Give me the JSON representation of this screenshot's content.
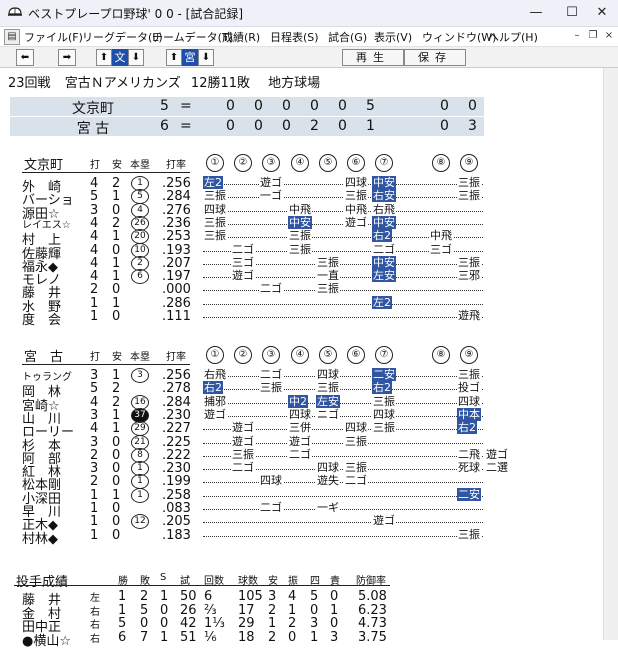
{
  "window": {
    "title": "ベストプレープロ野球' 0 0 - [試合記録]"
  },
  "menu": [
    "ファイル(F)",
    "リーグデータ(L)",
    "チームデータ(T)",
    "成績(R)",
    "日程表(S)",
    "試合(G)",
    "表示(V)",
    "ウィンドウ(W)",
    "ヘルプ(H)"
  ],
  "toolbar": {
    "prev": "⬅",
    "next": "➡",
    "up": "⬆",
    "down": "⬇",
    "bun_label": "文",
    "miyako_label": "宮",
    "replay_label": "再生",
    "save_label": "保存"
  },
  "game": {
    "round": "23回戦",
    "matchup": "宮古Ｎアメリカンズ",
    "record": "12勝11敗",
    "venue": "地方球場"
  },
  "scoreboard": [
    {
      "team": "文京町",
      "runs": "5",
      "innings": [
        "0",
        "0",
        "0",
        "0",
        "0",
        "5"
      ],
      "hits": "0",
      "errors": "0"
    },
    {
      "team": "宮 古",
      "runs": "6",
      "innings": [
        "0",
        "0",
        "0",
        "2",
        "0",
        "1"
      ],
      "hits": "0",
      "errors": "3"
    }
  ],
  "columns": {
    "da": "打",
    "an": "安",
    "hr": "本塁",
    "avg": "打率"
  },
  "innings_hdr": [
    "①",
    "②",
    "③",
    "④",
    "⑤",
    "⑥",
    "⑦",
    "⑧",
    "⑨"
  ],
  "away": {
    "name": "文京町",
    "rows": [
      {
        "name": "外　崎",
        "ab": "4",
        "h": "2",
        "hr": "1",
        "avg": ".256",
        "results": [
          {
            "i": 0,
            "t": "左2",
            "hl": true
          },
          {
            "i": 2,
            "t": "遊ゴ"
          },
          {
            "i": 5,
            "t": "四球"
          },
          {
            "i": 6,
            "t": "中安",
            "hl": true
          },
          {
            "i": 8,
            "t": "三振"
          }
        ]
      },
      {
        "name": "バーショ",
        "ab": "5",
        "h": "1",
        "hr": "5",
        "avg": ".284",
        "results": [
          {
            "i": 0,
            "t": "三振"
          },
          {
            "i": 2,
            "t": "一ゴ"
          },
          {
            "i": 5,
            "t": "三振"
          },
          {
            "i": 6,
            "t": "右安",
            "hl": true
          },
          {
            "i": 8,
            "t": "三振"
          }
        ]
      },
      {
        "name": "源田☆",
        "ab": "3",
        "h": "0",
        "hr": "4",
        "avg": ".276",
        "results": [
          {
            "i": 0,
            "t": "四球"
          },
          {
            "i": 3,
            "t": "中飛"
          },
          {
            "i": 5,
            "t": "中飛"
          },
          {
            "i": 6,
            "t": "右飛"
          }
        ]
      },
      {
        "name": "レイエス☆",
        "ab": "4",
        "h": "2",
        "hr": "26",
        "avg": ".236",
        "results": [
          {
            "i": 0,
            "t": "三振"
          },
          {
            "i": 3,
            "t": "中安",
            "hl": true
          },
          {
            "i": 5,
            "t": "遊ゴ"
          },
          {
            "i": 6,
            "t": "中安",
            "hl": true
          }
        ]
      },
      {
        "name": "村　上",
        "ab": "4",
        "h": "1",
        "hr": "20",
        "avg": ".253",
        "results": [
          {
            "i": 0,
            "t": "三振"
          },
          {
            "i": 3,
            "t": "三振"
          },
          {
            "i": 6,
            "t": "右2",
            "hl": true
          },
          {
            "i": 7,
            "t": "中飛"
          }
        ]
      },
      {
        "name": "佐藤輝",
        "ab": "4",
        "h": "0",
        "hr": "10",
        "avg": ".193",
        "results": [
          {
            "i": 1,
            "t": "二ゴ"
          },
          {
            "i": 3,
            "t": "三振"
          },
          {
            "i": 6,
            "t": "二ゴ"
          },
          {
            "i": 7,
            "t": "三ゴ"
          }
        ]
      },
      {
        "name": "福永◆",
        "ab": "4",
        "h": "1",
        "hr": "2",
        "avg": ".207",
        "results": [
          {
            "i": 1,
            "t": "三ゴ"
          },
          {
            "i": 4,
            "t": "三振"
          },
          {
            "i": 6,
            "t": "中安",
            "hl": true
          },
          {
            "i": 8,
            "t": "三振"
          }
        ]
      },
      {
        "name": "モレノ",
        "ab": "4",
        "h": "1",
        "hr": "6",
        "avg": ".197",
        "results": [
          {
            "i": 1,
            "t": "遊ゴ"
          },
          {
            "i": 4,
            "t": "一直"
          },
          {
            "i": 6,
            "t": "左安",
            "hl": true
          },
          {
            "i": 8,
            "t": "三邪"
          }
        ]
      },
      {
        "name": "藤　井",
        "ab": "2",
        "h": "0",
        "hr": "",
        "avg": ".000",
        "results": [
          {
            "i": 2,
            "t": "二ゴ"
          },
          {
            "i": 4,
            "t": "三振"
          }
        ]
      },
      {
        "name": "水　野",
        "ab": "1",
        "h": "1",
        "hr": "",
        "avg": ".286",
        "results": [
          {
            "i": 6,
            "t": "左2",
            "hl": true
          }
        ]
      },
      {
        "name": "度　会",
        "ab": "1",
        "h": "0",
        "hr": "",
        "avg": ".111",
        "results": [
          {
            "i": 8,
            "t": "遊飛"
          }
        ]
      }
    ]
  },
  "home": {
    "name": "宮　古",
    "rows": [
      {
        "name": "トゥラング",
        "ab": "3",
        "h": "1",
        "hr": "3",
        "hr_dark": false,
        "avg": ".256",
        "results": [
          {
            "i": 0,
            "t": "右飛"
          },
          {
            "i": 2,
            "t": "二ゴ"
          },
          {
            "i": 4,
            "t": "四球"
          },
          {
            "i": 6,
            "t": "二安",
            "hl": true
          },
          {
            "i": 8,
            "t": "三振"
          }
        ]
      },
      {
        "name": "岡　林",
        "ab": "5",
        "h": "2",
        "hr": "",
        "hr_dark": false,
        "avg": ".278",
        "results": [
          {
            "i": 0,
            "t": "右2",
            "hl": true
          },
          {
            "i": 2,
            "t": "三振"
          },
          {
            "i": 4,
            "t": "三振"
          },
          {
            "i": 6,
            "t": "右2",
            "hl": true
          },
          {
            "i": 8,
            "t": "投ゴ"
          }
        ]
      },
      {
        "name": "宮崎☆",
        "ab": "4",
        "h": "2",
        "hr": "16",
        "hr_dark": false,
        "avg": ".284",
        "results": [
          {
            "i": 0,
            "t": "捕邪"
          },
          {
            "i": 3,
            "t": "中2",
            "hl": true
          },
          {
            "i": 4,
            "t": "左安",
            "hl": true
          },
          {
            "i": 6,
            "t": "三振"
          },
          {
            "i": 8,
            "t": "四球"
          }
        ]
      },
      {
        "name": "山　川",
        "ab": "3",
        "h": "1",
        "hr": "37",
        "hr_dark": true,
        "avg": ".230",
        "results": [
          {
            "i": 0,
            "t": "遊ゴ"
          },
          {
            "i": 3,
            "t": "四球"
          },
          {
            "i": 4,
            "t": "ニゴ"
          },
          {
            "i": 6,
            "t": "四球"
          },
          {
            "i": 8,
            "t": "中本",
            "hl": true
          }
        ]
      },
      {
        "name": "ローリー",
        "ab": "4",
        "h": "1",
        "hr": "29",
        "hr_dark": false,
        "avg": ".227",
        "results": [
          {
            "i": 1,
            "t": "遊ゴ"
          },
          {
            "i": 3,
            "t": "三併"
          },
          {
            "i": 5,
            "t": "四球"
          },
          {
            "i": 6,
            "t": "三振"
          },
          {
            "i": 8,
            "t": "右2",
            "hl": true
          }
        ]
      },
      {
        "name": "杉　本",
        "ab": "3",
        "h": "0",
        "hr": "21",
        "hr_dark": false,
        "avg": ".225",
        "results": [
          {
            "i": 1,
            "t": "遊ゴ"
          },
          {
            "i": 3,
            "t": "遊ゴ"
          },
          {
            "i": 5,
            "t": "三振"
          }
        ]
      },
      {
        "name": "阿　部",
        "ab": "2",
        "h": "0",
        "hr": "8",
        "hr_dark": false,
        "avg": ".222",
        "results": [
          {
            "i": 1,
            "t": "三振"
          },
          {
            "i": 3,
            "t": "二ゴ"
          },
          {
            "i": 8,
            "t": "二飛"
          },
          {
            "i": 8,
            "t": "遊ゴ",
            "shift": true
          }
        ]
      },
      {
        "name": "紅　林",
        "ab": "3",
        "h": "0",
        "hr": "1",
        "hr_dark": false,
        "avg": ".230",
        "results": [
          {
            "i": 1,
            "t": "二ゴ"
          },
          {
            "i": 4,
            "t": "四球"
          },
          {
            "i": 5,
            "t": "三振"
          },
          {
            "i": 8,
            "t": "死球"
          },
          {
            "i": 8,
            "t": "二選",
            "shift": true
          }
        ]
      },
      {
        "name": "松本剛",
        "ab": "2",
        "h": "0",
        "hr": "1",
        "hr_dark": false,
        "avg": ".199",
        "results": [
          {
            "i": 2,
            "t": "四球"
          },
          {
            "i": 4,
            "t": "遊失"
          },
          {
            "i": 5,
            "t": "二ゴ"
          }
        ]
      },
      {
        "name": "小深田",
        "ab": "1",
        "h": "1",
        "hr": "1",
        "hr_dark": false,
        "avg": ".258",
        "results": [
          {
            "i": 8,
            "t": "二安",
            "hl": true
          }
        ]
      },
      {
        "name": "早　川",
        "ab": "1",
        "h": "0",
        "hr": "",
        "hr_dark": false,
        "avg": ".083",
        "results": [
          {
            "i": 2,
            "t": "二ゴ"
          },
          {
            "i": 4,
            "t": "一ギ"
          }
        ]
      },
      {
        "name": "正木◆",
        "ab": "1",
        "h": "0",
        "hr": "12",
        "hr_dark": false,
        "avg": ".205",
        "results": [
          {
            "i": 6,
            "t": "遊ゴ"
          }
        ]
      },
      {
        "name": "村林◆",
        "ab": "1",
        "h": "0",
        "hr": "",
        "hr_dark": false,
        "avg": ".183",
        "results": [
          {
            "i": 8,
            "t": "三振"
          }
        ]
      }
    ]
  },
  "pitching": {
    "title": "投手成績",
    "headers": [
      "勝",
      "敗",
      "S",
      "試",
      "回数",
      "球数",
      "安",
      "振",
      "四",
      "責",
      "防御率"
    ],
    "rows": [
      {
        "name": "藤　井",
        "hand": "左",
        "vals": [
          "1",
          "2",
          "1",
          "50",
          "6",
          "105",
          "3",
          "4",
          "5",
          "0",
          "5.08"
        ]
      },
      {
        "name": "金　村",
        "hand": "右",
        "vals": [
          "1",
          "5",
          "0",
          "26",
          "⅔",
          "17",
          "2",
          "1",
          "0",
          "1",
          "6.23"
        ]
      },
      {
        "name": "田中正",
        "hand": "右",
        "vals": [
          "5",
          "0",
          "0",
          "42",
          "1⅓",
          "29",
          "1",
          "2",
          "3",
          "0",
          "4.73"
        ]
      },
      {
        "name": "●横山☆",
        "hand": "右",
        "vals": [
          "6",
          "7",
          "1",
          "51",
          "⅙",
          "18",
          "2",
          "0",
          "1",
          "3",
          "3.75"
        ]
      }
    ]
  }
}
